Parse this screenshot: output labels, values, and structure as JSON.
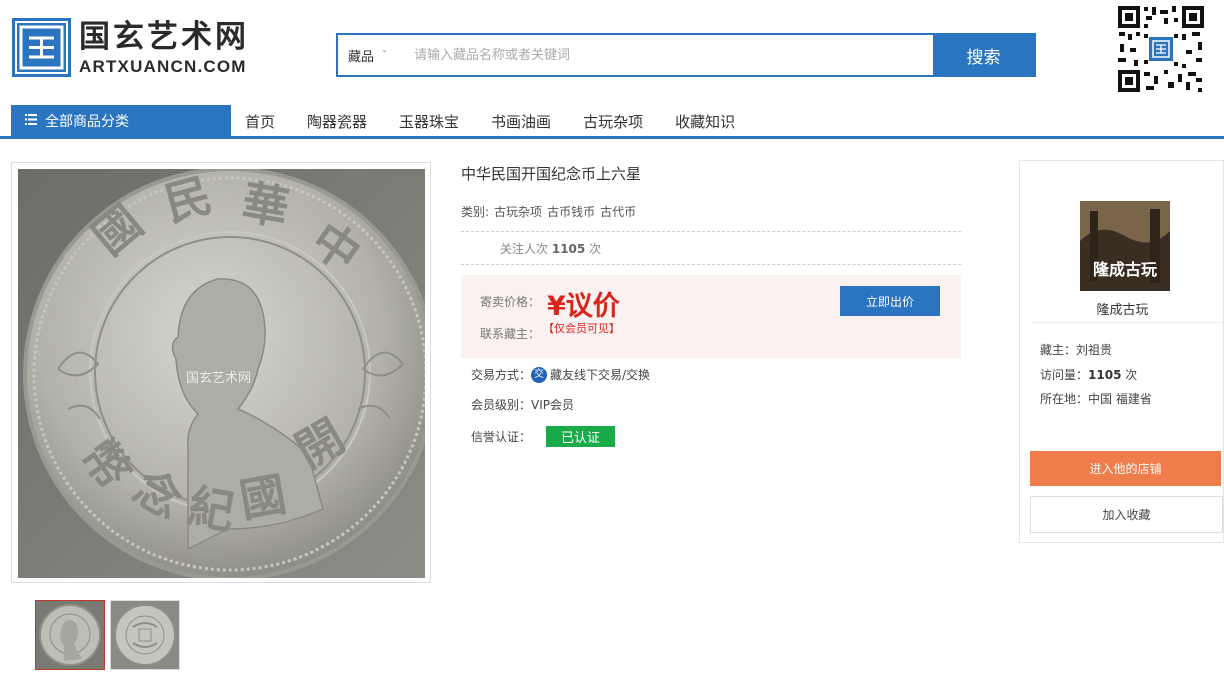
{
  "logo": {
    "cn": "国玄艺术网",
    "en": "ARTXUANCN.COM"
  },
  "search": {
    "scope": "藏品",
    "placeholder": "请输入藏品名称或者关键词",
    "button": "搜索"
  },
  "nav": {
    "category_button": "全部商品分类",
    "items": [
      "首页",
      "陶器瓷器",
      "玉器珠宝",
      "书画油画",
      "古玩杂项",
      "收藏知识"
    ]
  },
  "gallery": {
    "watermark": "国玄艺术网"
  },
  "item": {
    "title": "中华民国开国纪念币上六星",
    "category_label": "类别:",
    "categories": [
      "古玩杂项",
      "古币钱币",
      "古代币"
    ],
    "follow_label": "关注人次",
    "follow_count": "1105",
    "follow_unit": "次",
    "price_label": "寄卖价格：",
    "price": "¥议价",
    "contact_label": "联系藏主：",
    "contact_value": "【仅会员可见】",
    "bid_button": "立即出价",
    "trade_label": "交易方式：",
    "trade_value": "藏友线下交易/交换",
    "member_label": "会员级别：",
    "member_value": "VIP会员",
    "credit_label": "信誉认证：",
    "credit_value": "已认证"
  },
  "seller": {
    "logo_text": "隆成古玩",
    "shop_name": "隆成古玩",
    "owner_label": "藏主：",
    "owner": "刘祖贵",
    "visits_label": "访问量：",
    "visits": "1105",
    "visits_unit": "次",
    "location_label": "所在地：",
    "location": "中国 福建省",
    "enter_button": "进入他的店铺",
    "favorite_button": "加入收藏"
  },
  "colors": {
    "brand_blue": "#2a74c0",
    "price_red": "#d9261c",
    "verified_green": "#1aaa4a",
    "enter_orange": "#ef7d4c"
  }
}
